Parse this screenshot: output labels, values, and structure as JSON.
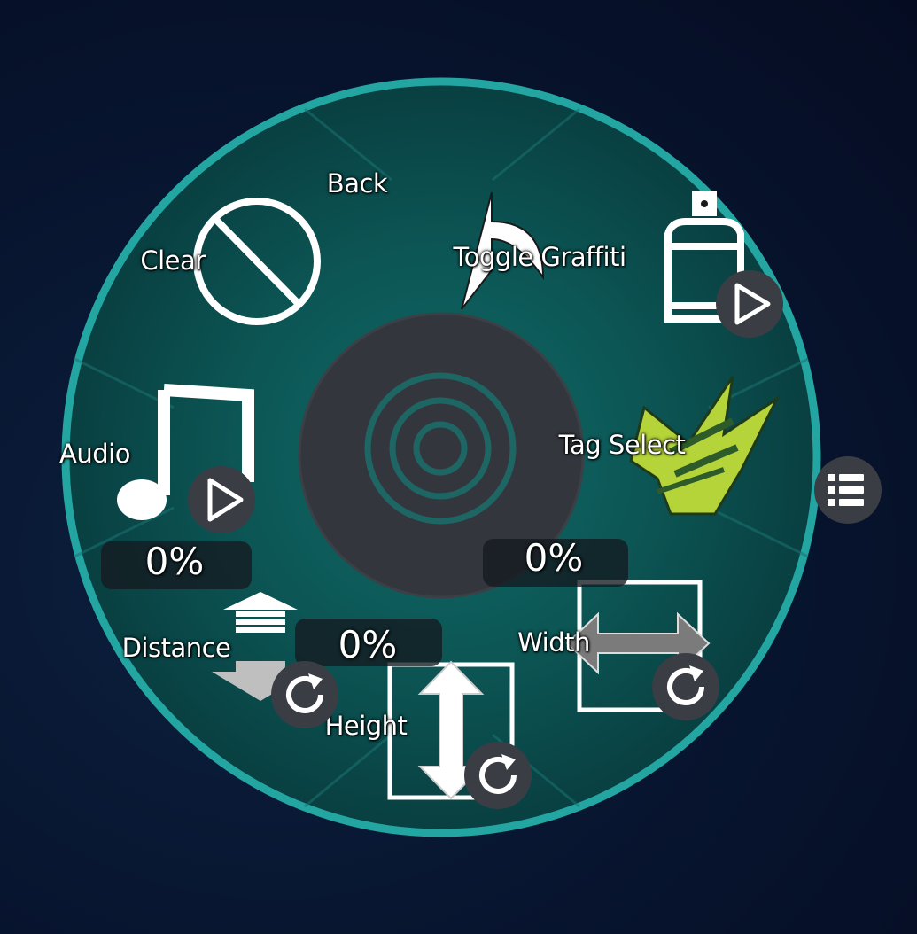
{
  "wheel": {
    "colors": {
      "ring": "#0b4f50",
      "rim": "#23a5a2",
      "hub": "#33373d",
      "hub_rings": "#1e6664"
    },
    "items": {
      "back": {
        "label": "Back",
        "icon": "back-arrow-icon"
      },
      "toggle_graffiti": {
        "label": "Toggle Graffiti",
        "icon": "spray-can-icon",
        "badge": "play-icon"
      },
      "tag_select": {
        "label": "Tag Select",
        "icon": "jet-set-radio-logo",
        "badge": "list-icon"
      },
      "width": {
        "label": "Width",
        "value": "0%",
        "icon": "horizontal-resize-icon",
        "badge": "reset-icon"
      },
      "height": {
        "label": "Height",
        "value": "0%",
        "icon": "vertical-resize-icon",
        "badge": "reset-icon"
      },
      "distance": {
        "label": "Distance",
        "value": "0%",
        "icon": "distance-arrow-icon",
        "badge": "reset-icon"
      },
      "audio": {
        "label": "Audio",
        "icon": "music-note-icon",
        "badge": "play-icon"
      },
      "clear": {
        "label": "Clear",
        "icon": "prohibited-icon"
      }
    }
  }
}
